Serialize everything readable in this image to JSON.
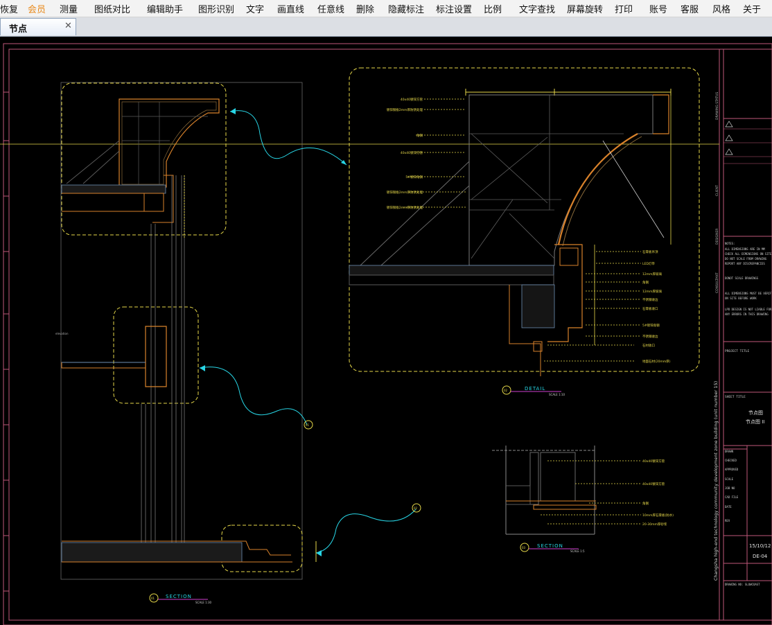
{
  "menu": {
    "items": [
      {
        "key": "restore",
        "label": "恢复"
      },
      {
        "key": "member",
        "label": "会员",
        "active": true
      },
      {
        "key": "measure",
        "label": "测量"
      },
      {
        "key": "compare",
        "label": "图纸对比"
      },
      {
        "key": "edit-helper",
        "label": "编辑助手"
      },
      {
        "key": "shape-recog",
        "label": "图形识别"
      },
      {
        "key": "text",
        "label": "文字"
      },
      {
        "key": "line",
        "label": "画直线"
      },
      {
        "key": "freeline",
        "label": "任意线"
      },
      {
        "key": "delete",
        "label": "删除"
      },
      {
        "key": "hide-annot",
        "label": "隐藏标注"
      },
      {
        "key": "annot-settings",
        "label": "标注设置"
      },
      {
        "key": "scale",
        "label": "比例"
      },
      {
        "key": "find-text",
        "label": "文字查找"
      },
      {
        "key": "rotate",
        "label": "屏幕旋转"
      },
      {
        "key": "print",
        "label": "打印"
      },
      {
        "key": "account",
        "label": "账号"
      },
      {
        "key": "service",
        "label": "客服"
      },
      {
        "key": "style",
        "label": "风格"
      },
      {
        "key": "about",
        "label": "关于"
      }
    ]
  },
  "tab": {
    "label": "节点",
    "close_icon": "close-icon"
  },
  "drawing": {
    "section_title": "SECTION",
    "section_scale": "SCALE 1:30",
    "section_num": "01",
    "detail_title": "DETAIL",
    "detail_scale": "SCALE 1:10",
    "detail_num": "02",
    "section2_title": "SECTION",
    "section2_scale": "SCALE 1:5",
    "section2_num": "03",
    "callout1": "01",
    "callout2": "02",
    "detail_labels": [
      "40x40镀锌方管",
      "镀锌钢板2mm厚防锈处理",
      "角钢",
      "40x40镀锌方管",
      "5#镀锌角钢",
      "镀锌钢板2mm厚防锈处理",
      "镀锌钢板2mm厚防锈处理"
    ],
    "detail_labels_right": [
      "石膏板吊顶",
      "LED灯带",
      "12mm厚玻璃",
      "角钢",
      "12mm厚玻璃",
      "不锈钢收边",
      "石膏板收口",
      "5#镀锌角钢",
      "不锈钢收边",
      "石材收口",
      "地面石材(20mm厚)"
    ],
    "section2_labels": [
      "40x40镀锌方管",
      "40x40镀锌方管",
      "角钢",
      "10mm厚石膏板(防水)",
      "20-30mm厚砂浆"
    ],
    "titleblock": {
      "project_title": "Changsha high-end technology community development zone building (unit number 15)",
      "revision": "REVISIONS",
      "sheet_title": "SHEET TITLE",
      "project_name": "PROJECT TITLE",
      "name1": "节点图",
      "name2": "节点图 II",
      "date": "15/10/12",
      "sheet_no": "DE-04",
      "footer": "DRAWING NO: SLOWCOAST"
    }
  },
  "colors": {
    "member_active": "#e8891a",
    "frame": "#c0587a",
    "yellow_dashed": "#e7d94a",
    "orange": "#d9822b",
    "cyan": "#28d6e6",
    "magenta": "#d040d0"
  }
}
